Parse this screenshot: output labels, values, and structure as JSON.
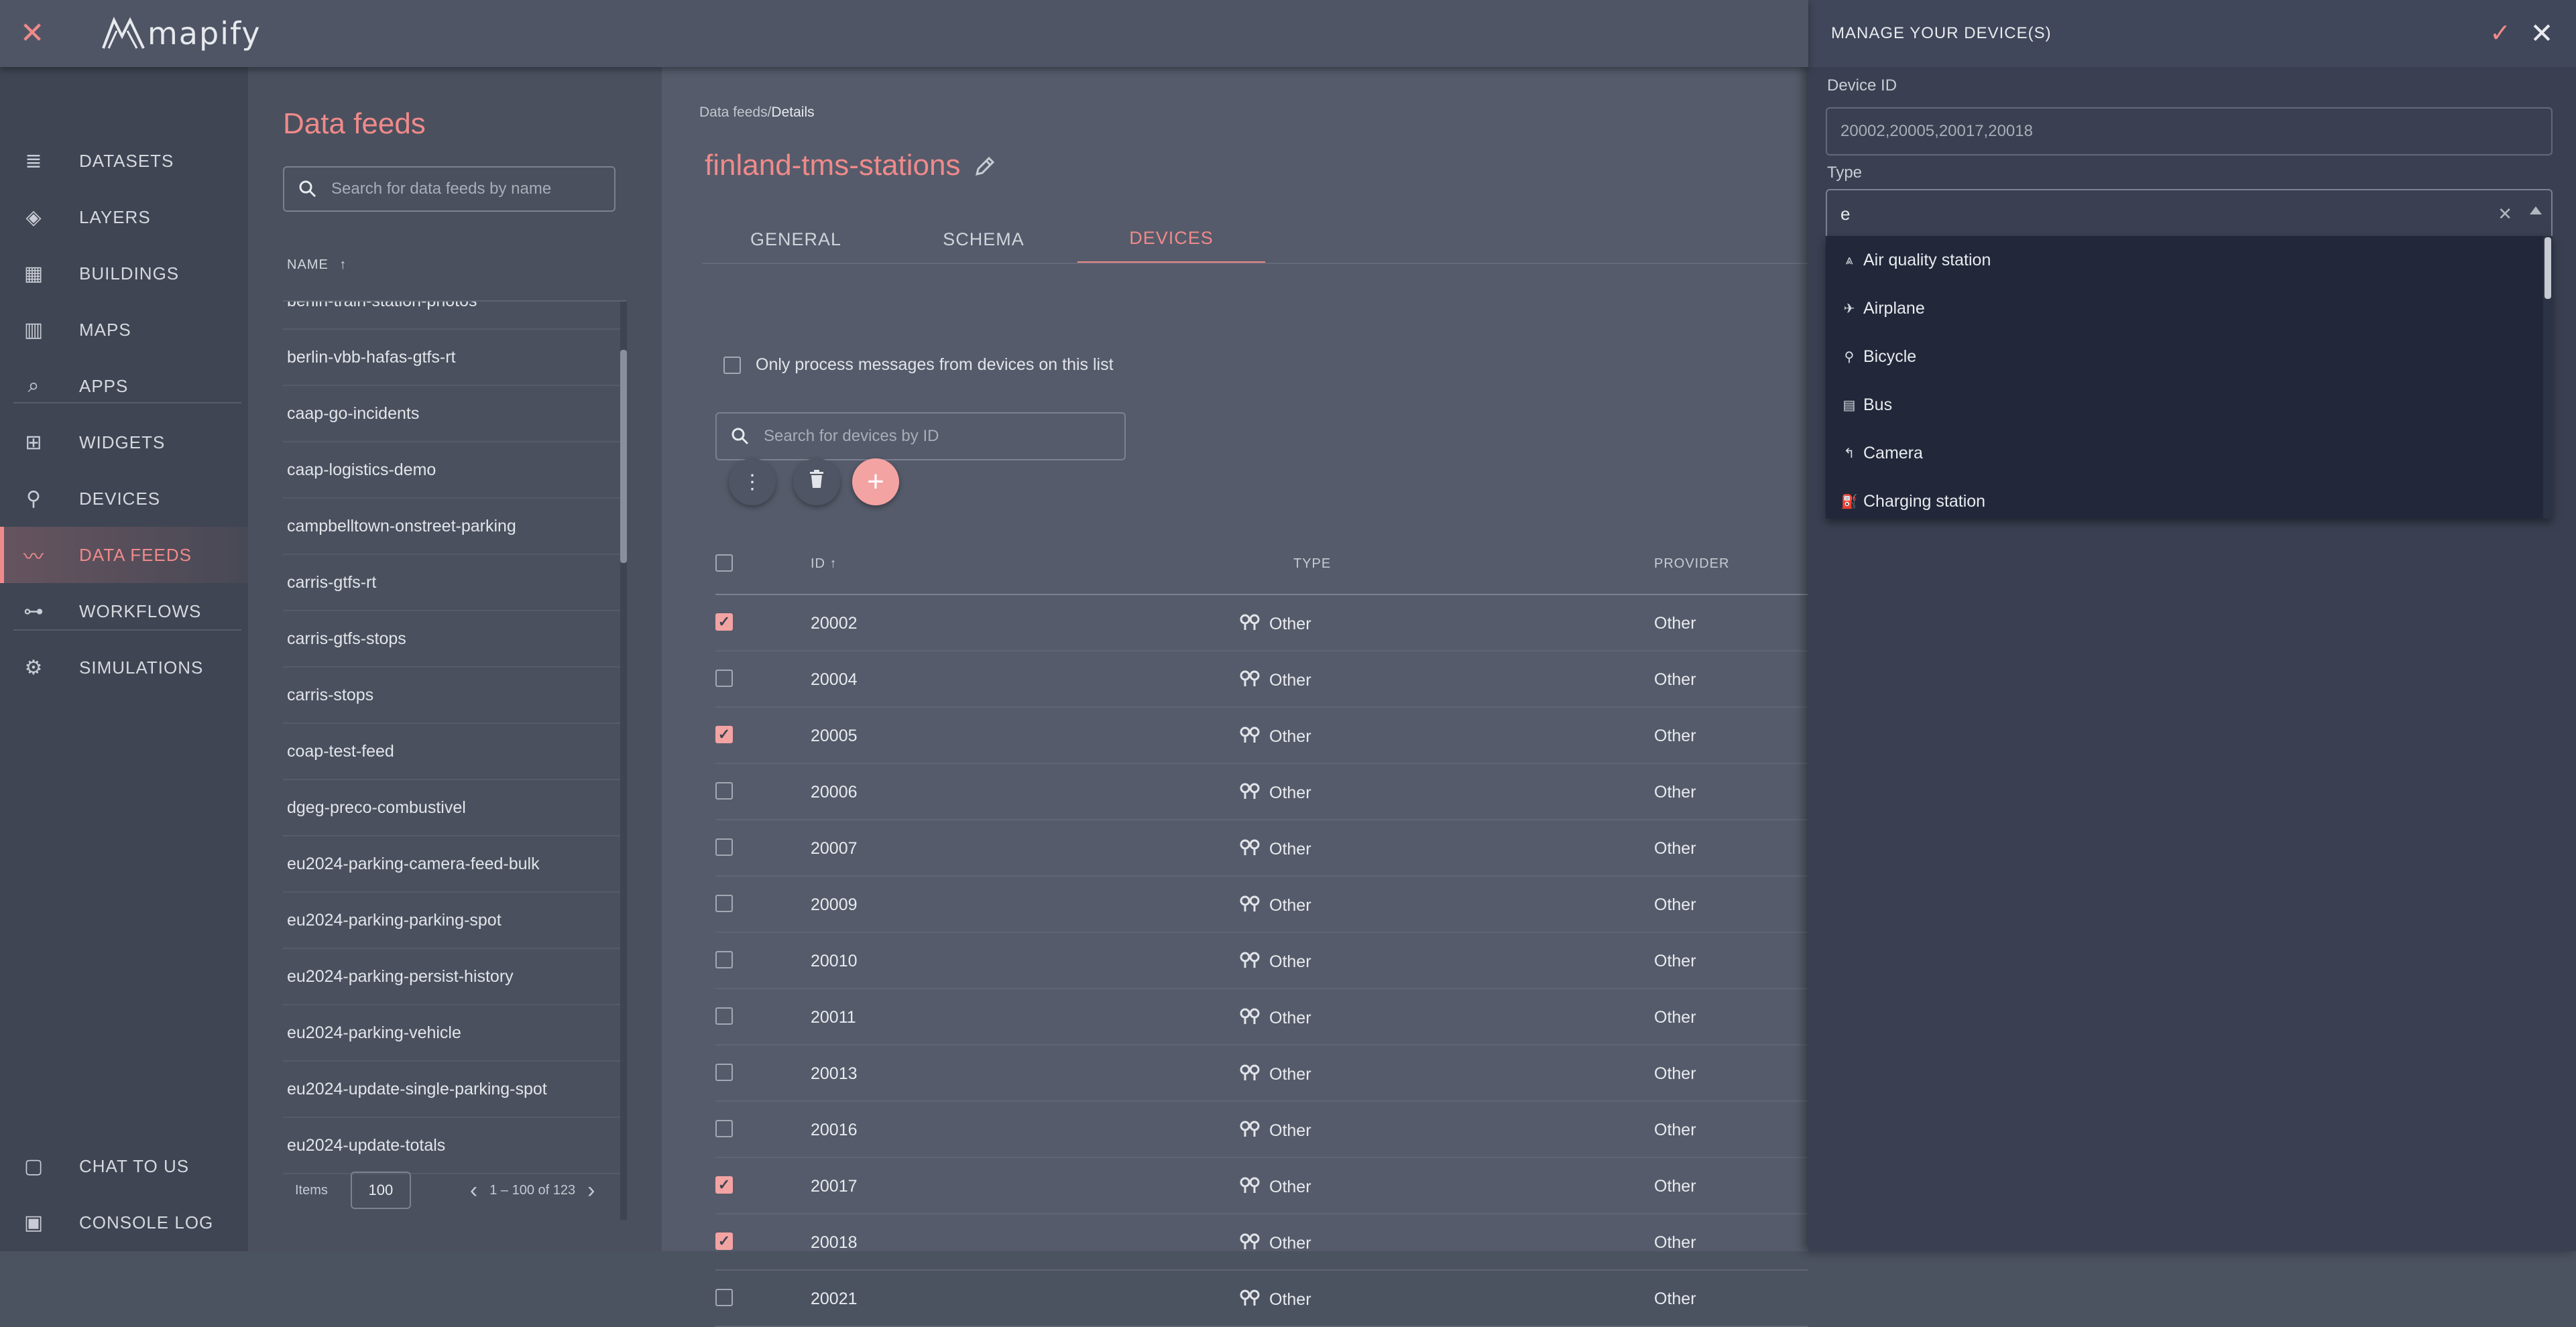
{
  "app": {
    "logo_text": "mapify"
  },
  "nav": {
    "items": [
      {
        "label": "DATASETS",
        "icon": "database-icon"
      },
      {
        "label": "LAYERS",
        "icon": "layers-icon"
      },
      {
        "label": "BUILDINGS",
        "icon": "buildings-icon"
      },
      {
        "label": "MAPS",
        "icon": "map-icon"
      },
      {
        "label": "APPS",
        "icon": "apps-icon"
      },
      {
        "label": "WIDGETS",
        "icon": "widgets-icon"
      },
      {
        "label": "DEVICES",
        "icon": "devices-icon"
      },
      {
        "label": "DATA FEEDS",
        "icon": "rss-icon",
        "active": true
      },
      {
        "label": "WORKFLOWS",
        "icon": "workflow-icon"
      },
      {
        "label": "SIMULATIONS",
        "icon": "robot-icon"
      }
    ],
    "bottom": [
      {
        "label": "CHAT TO US",
        "icon": "chat-icon"
      },
      {
        "label": "CONSOLE LOG",
        "icon": "console-icon"
      }
    ]
  },
  "feeds": {
    "title": "Data feeds",
    "search_placeholder": "Search for data feeds by name",
    "column_header": "NAME",
    "rows": [
      "berlin-train-station-photos",
      "berlin-vbb-hafas-gtfs-rt",
      "caap-go-incidents",
      "caap-logistics-demo",
      "campbelltown-onstreet-parking",
      "carris-gtfs-rt",
      "carris-gtfs-stops",
      "carris-stops",
      "coap-test-feed",
      "dgeg-preco-combustivel",
      "eu2024-parking-camera-feed-bulk",
      "eu2024-parking-parking-spot",
      "eu2024-parking-persist-history",
      "eu2024-parking-vehicle",
      "eu2024-update-single-parking-spot",
      "eu2024-update-totals"
    ],
    "items_label": "Items",
    "items_value": "100",
    "range_text": "1 – 100 of 123"
  },
  "details": {
    "breadcrumb_parent": "Data feeds",
    "breadcrumb_sep": "/",
    "breadcrumb_current": "Details",
    "title": "finland-tms-stations",
    "tabs": [
      "GENERAL",
      "SCHEMA",
      "DEVICES"
    ],
    "active_tab": 2,
    "only_process_label": "Only process messages from devices on this list",
    "search_placeholder": "Search for devices by ID",
    "columns": {
      "id": "ID",
      "type": "TYPE",
      "provider": "PROVIDER"
    },
    "rows": [
      {
        "id": "20002",
        "type": "Other",
        "provider": "Other",
        "checked": true
      },
      {
        "id": "20004",
        "type": "Other",
        "provider": "Other",
        "checked": false
      },
      {
        "id": "20005",
        "type": "Other",
        "provider": "Other",
        "checked": true
      },
      {
        "id": "20006",
        "type": "Other",
        "provider": "Other",
        "checked": false
      },
      {
        "id": "20007",
        "type": "Other",
        "provider": "Other",
        "checked": false
      },
      {
        "id": "20009",
        "type": "Other",
        "provider": "Other",
        "checked": false
      },
      {
        "id": "20010",
        "type": "Other",
        "provider": "Other",
        "checked": false
      },
      {
        "id": "20011",
        "type": "Other",
        "provider": "Other",
        "checked": false
      },
      {
        "id": "20013",
        "type": "Other",
        "provider": "Other",
        "checked": false
      },
      {
        "id": "20016",
        "type": "Other",
        "provider": "Other",
        "checked": false
      },
      {
        "id": "20017",
        "type": "Other",
        "provider": "Other",
        "checked": true
      },
      {
        "id": "20018",
        "type": "Other",
        "provider": "Other",
        "checked": true
      },
      {
        "id": "20021",
        "type": "Other",
        "provider": "Other",
        "checked": false
      }
    ]
  },
  "drawer": {
    "title": "MANAGE YOUR DEVICE(S)",
    "device_id_label": "Device ID",
    "device_id_value": "20002,20005,20017,20018",
    "type_label": "Type",
    "type_value": "e",
    "options": [
      {
        "label": "Air quality station",
        "icon": "air-quality-icon",
        "glyph": "⩓"
      },
      {
        "label": "Airplane",
        "icon": "airplane-icon",
        "glyph": "✈"
      },
      {
        "label": "Bicycle",
        "icon": "bicycle-icon",
        "glyph": "⚲"
      },
      {
        "label": "Bus",
        "icon": "bus-icon",
        "glyph": "▤"
      },
      {
        "label": "Camera",
        "icon": "camera-icon",
        "glyph": "↰"
      },
      {
        "label": "Charging station",
        "icon": "charging-station-icon",
        "glyph": "⛽"
      }
    ]
  },
  "colors": {
    "accent": "#f08a8a",
    "checkbox_checked": "#f4a3a3"
  }
}
